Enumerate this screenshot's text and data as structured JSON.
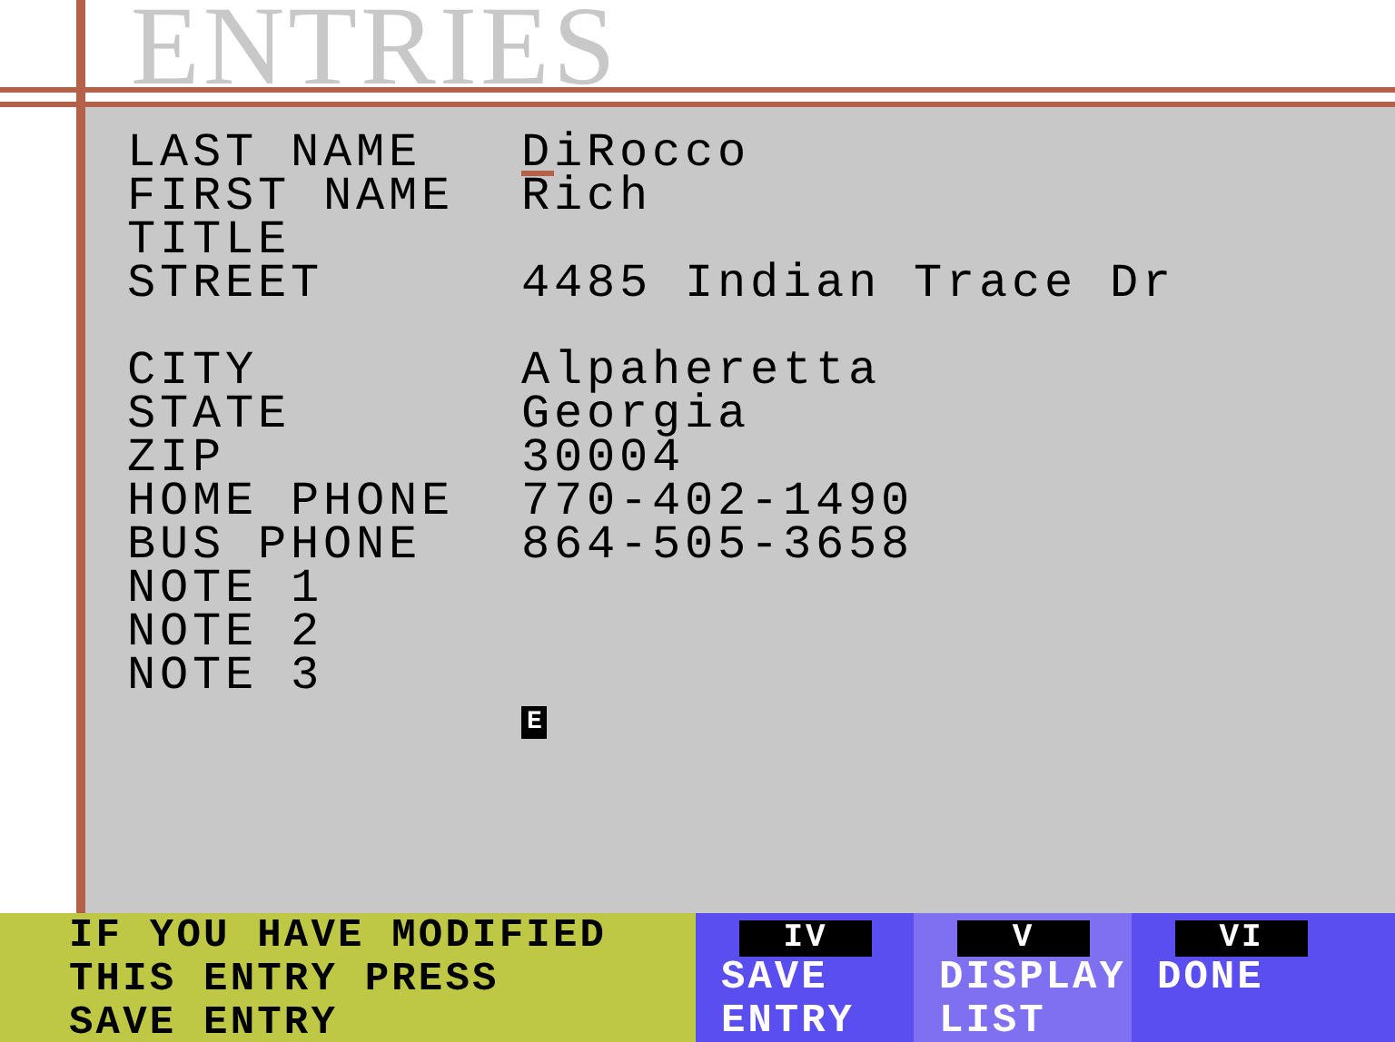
{
  "title": "ENTRIES",
  "fields": [
    {
      "kind": "field",
      "label": "LAST NAME",
      "value": "DiRocco",
      "cursor": true
    },
    {
      "kind": "field",
      "label": "FIRST NAME",
      "value": "Rich",
      "cursor": false
    },
    {
      "kind": "field",
      "label": "TITLE",
      "cursor": false
    },
    {
      "kind": "field",
      "label": "STREET",
      "value": "4485 Indian Trace Dr",
      "cursor": false
    },
    {
      "kind": "blank"
    },
    {
      "kind": "field",
      "label": "CITY",
      "value": "Alpaheretta",
      "cursor": false
    },
    {
      "kind": "field",
      "label": "STATE",
      "value": "Georgia",
      "cursor": false
    },
    {
      "kind": "field",
      "label": "ZIP",
      "value": "30004",
      "cursor": false
    },
    {
      "kind": "field",
      "label": "HOME PHONE",
      "value": "770-402-1490",
      "cursor": false
    },
    {
      "kind": "field",
      "label": "BUS PHONE",
      "value": "864-505-3658",
      "cursor": false
    },
    {
      "kind": "field",
      "label": "NOTE 1",
      "cursor": false
    },
    {
      "kind": "field",
      "label": "NOTE 2",
      "cursor": false
    },
    {
      "kind": "field",
      "label": "NOTE 3",
      "cursor": false
    }
  ],
  "prompt": "E",
  "message": [
    "IF YOU HAVE MODIFIED",
    "THIS ENTRY PRESS",
    "SAVE ENTRY"
  ],
  "buttons": [
    {
      "key": "IV",
      "lines": [
        "SAVE",
        "ENTRY"
      ],
      "selected": false
    },
    {
      "key": "V",
      "lines": [
        "DISPLAY",
        "LIST"
      ],
      "selected": true
    },
    {
      "key": "VI",
      "lines": [
        "DONE"
      ],
      "selected": false
    }
  ]
}
